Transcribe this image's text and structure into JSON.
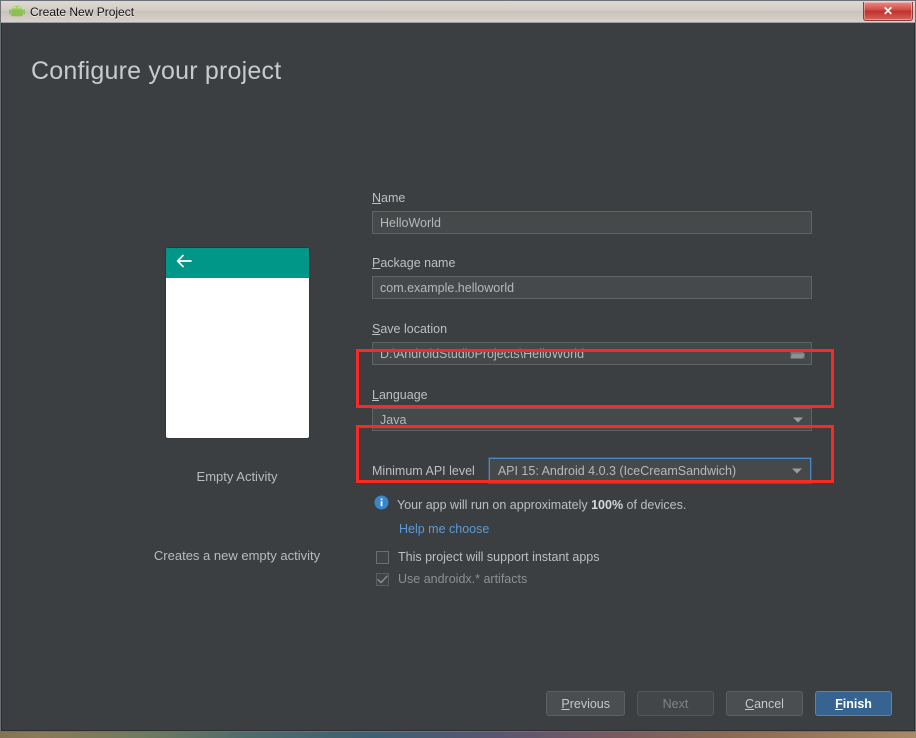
{
  "window": {
    "title": "Create New Project",
    "icon": "android-icon",
    "close_label": "✕"
  },
  "dialog": {
    "heading": "Configure your project"
  },
  "preview": {
    "back_icon": "back-arrow-icon",
    "title": "Empty Activity",
    "description": "Creates a new empty activity",
    "appbar_color": "#009688"
  },
  "form": {
    "name": {
      "label_mnemonic": "N",
      "label_rest": "ame",
      "value": "HelloWorld"
    },
    "package": {
      "label_mnemonic": "P",
      "label_rest": "ackage name",
      "value": "com.example.helloworld"
    },
    "save_location": {
      "label_mnemonic": "S",
      "label_rest": "ave location",
      "value": "D:\\AndroidStudioProjects\\HelloWorld",
      "browse_icon": "folder-open-icon",
      "highlighted": true
    },
    "language": {
      "label_mnemonic": "L",
      "label_rest": "anguage",
      "value": "Java",
      "highlighted": true
    },
    "api_level": {
      "label": "Minimum API level",
      "value": "API 15: Android 4.0.3 (IceCreamSandwich)"
    },
    "devices_info": {
      "icon": "info-icon",
      "text_before": "Your app will run on approximately ",
      "percent": "100%",
      "text_after": " of devices."
    },
    "help_link": "Help me choose",
    "instant_apps": {
      "label": "This project will support instant apps",
      "checked": false
    },
    "androidx": {
      "label": "Use androidx.* artifacts",
      "checked": true,
      "disabled": true,
      "check_glyph": "✓"
    }
  },
  "footer": {
    "previous": {
      "mnemonic": "P",
      "rest": "revious"
    },
    "next": {
      "label": "Next"
    },
    "cancel": {
      "mnemonic": "C",
      "rest": "ancel"
    },
    "finish": {
      "mnemonic": "F",
      "rest": "inish"
    }
  },
  "colors": {
    "accent_blue": "#4b87c4",
    "annotation_red": "#fa2a22",
    "teal": "#009688",
    "background": "#3c3f41"
  }
}
